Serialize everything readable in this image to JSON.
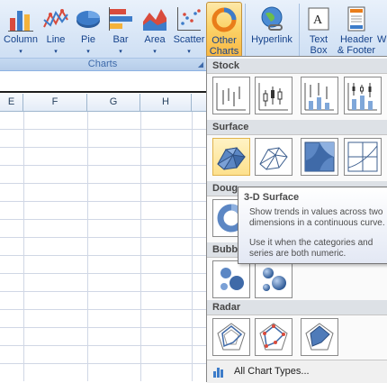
{
  "ribbon": {
    "buttons": [
      {
        "label": "Column",
        "name": "column-chart-button"
      },
      {
        "label": "Line",
        "name": "line-chart-button"
      },
      {
        "label": "Pie",
        "name": "pie-chart-button"
      },
      {
        "label": "Bar",
        "name": "bar-chart-button"
      },
      {
        "label": "Area",
        "name": "area-chart-button"
      },
      {
        "label": "Scatter",
        "name": "scatter-chart-button"
      },
      {
        "label_line1": "Other",
        "label_line2": "Charts",
        "name": "other-charts-button"
      },
      {
        "label": "Hyperlink",
        "name": "hyperlink-button"
      },
      {
        "label_line1": "Text",
        "label_line2": "Box",
        "name": "text-box-button"
      },
      {
        "label_line1": "Header",
        "label_line2": "& Footer",
        "name": "header-footer-button"
      },
      {
        "label": "W",
        "name": "wordart-button"
      }
    ],
    "group_label": "Charts"
  },
  "sheet": {
    "columns": [
      "E",
      "F",
      "G",
      "H"
    ]
  },
  "gallery": {
    "sections": {
      "stock": "Stock",
      "surface": "Surface",
      "doughnut": "Doug",
      "bubble": "Bubb",
      "radar": "Radar"
    },
    "footer_link": "All Chart Types...",
    "selected": "3-D Surface"
  },
  "tooltip": {
    "title": "3-D Surface",
    "desc1": "Show trends in values across two dimensions in a continuous curve.",
    "desc2": "Use it when the categories and series are both numeric."
  },
  "colors": {
    "ribbon_bg": "#d7e5f6",
    "active_button": "#fbd46a",
    "accent_blue": "#15428b",
    "panel_bg": "#fafafa"
  }
}
